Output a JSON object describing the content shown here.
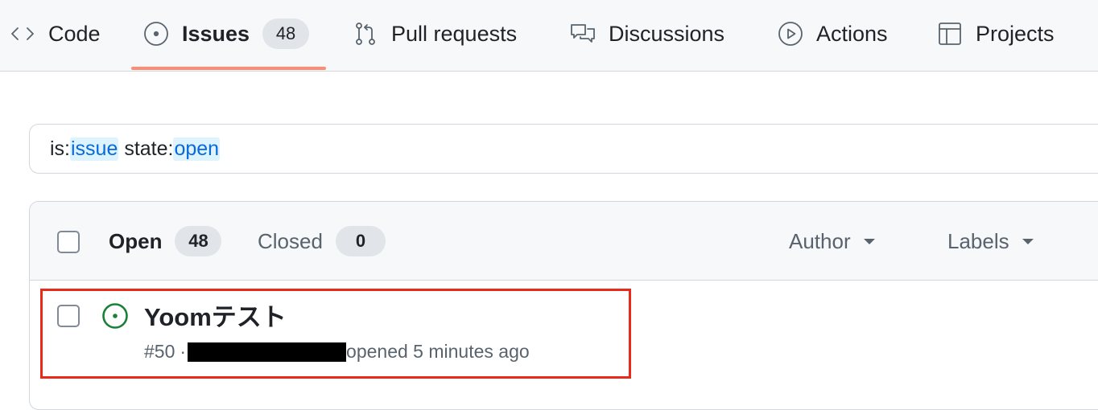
{
  "nav": {
    "tabs": [
      {
        "label": "Code",
        "icon": "code-icon"
      },
      {
        "label": "Issues",
        "icon": "issue-opened-icon",
        "count": "48",
        "selected": true
      },
      {
        "label": "Pull requests",
        "icon": "git-pull-request-icon"
      },
      {
        "label": "Discussions",
        "icon": "comment-discussion-icon"
      },
      {
        "label": "Actions",
        "icon": "play-icon"
      },
      {
        "label": "Projects",
        "icon": "table-icon"
      }
    ]
  },
  "search": {
    "prefix1": "is:",
    "value1": "issue",
    "prefix2": " state:",
    "value2": "open"
  },
  "issues_header": {
    "open_label": "Open",
    "open_count": "48",
    "closed_label": "Closed",
    "closed_count": "0",
    "filters": [
      "Author",
      "Labels"
    ]
  },
  "issues": [
    {
      "title": "Yoomテスト",
      "number": "#50",
      "separator": "·",
      "opened_text": "opened 5 minutes ago",
      "author_redacted": true
    }
  ],
  "colors": {
    "accent_underline": "#fd8c73",
    "open_icon": "#1a7f37",
    "highlight": "#e8291c",
    "search_token": "#0969da"
  }
}
